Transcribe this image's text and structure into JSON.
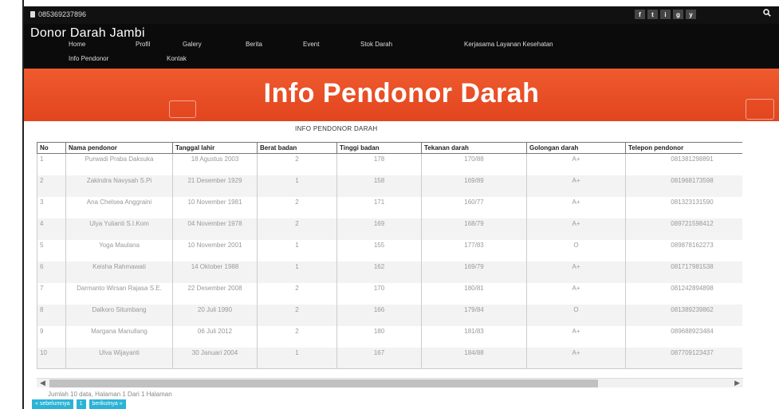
{
  "topbar": {
    "phone": "085369237896",
    "socials": [
      "f",
      "t",
      "i",
      "g",
      "y"
    ],
    "search_icon": "search-icon"
  },
  "header": {
    "brand": "Donor Darah Jambi",
    "nav": [
      "Home",
      "Profil",
      "Galery",
      "Berita",
      "Event",
      "Stok Darah",
      "Kerjasama Layanan Kesehatan",
      "Info Pendonor",
      "Kontak"
    ]
  },
  "hero": {
    "title": "Info Pendonor Darah"
  },
  "section": {
    "title": "INFO PENDONOR DARAH"
  },
  "table": {
    "headers": [
      "No",
      "Nama pendonor",
      "Tanggal lahir",
      "Berat badan",
      "Tinggi badan",
      "Tekanan darah",
      "Golongan darah",
      "Telepon pendonor"
    ],
    "rows": [
      [
        "1",
        "Purwadi Praba Daksuka",
        "18 Agustus 2003",
        "2",
        "178",
        "170/88",
        "A+",
        "081381298891"
      ],
      [
        "2",
        "Zakindra Navysah S.Pi",
        "21 Desember 1929",
        "1",
        "158",
        "169/89",
        "A+",
        "081968173598"
      ],
      [
        "3",
        "Ana Chelsea Anggraini",
        "10 November 1981",
        "2",
        "171",
        "160/77",
        "A+",
        "081323131590"
      ],
      [
        "4",
        "Ulya Yulianti S.I.Kom",
        "04 November 1978",
        "2",
        "169",
        "168/79",
        "A+",
        "089721598412"
      ],
      [
        "5",
        "Yoga Maulana",
        "10 November 2001",
        "1",
        "155",
        "177/83",
        "O",
        "089878162273"
      ],
      [
        "6",
        "Keisha Rahmawati",
        "14 Oktober 1988",
        "1",
        "162",
        "169/79",
        "A+",
        "081717981538"
      ],
      [
        "7",
        "Darmanto Wirsan Rajasa S.E.",
        "22 Desember 2008",
        "2",
        "170",
        "180/81",
        "A+",
        "081242894898"
      ],
      [
        "8",
        "Dalkoro Situmbang",
        "20 Juli 1990",
        "2",
        "166",
        "179/84",
        "O",
        "081389239862"
      ],
      [
        "9",
        "Margana Manullang",
        "06 Juli 2012",
        "2",
        "180",
        "181/83",
        "A+",
        "089688923484"
      ],
      [
        "10",
        "Ulva Wijayanti",
        "30 Januari 2004",
        "1",
        "167",
        "184/88",
        "A+",
        "087709123437"
      ]
    ]
  },
  "footer": {
    "info": "Jumlah 10 data, Halaman 1 Dari 1 Halaman",
    "prev": "« sebelumnya",
    "page": "1",
    "next": "berikutnya »"
  },
  "colors": {
    "hero": "#e2451f",
    "pager": "#2bb3d7"
  }
}
